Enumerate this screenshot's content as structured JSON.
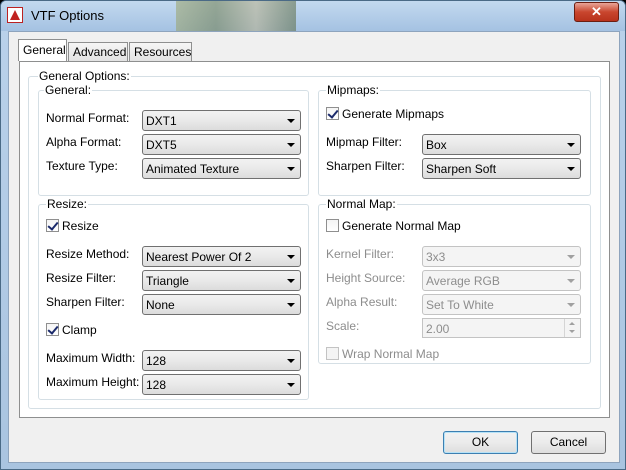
{
  "window": {
    "title": "VTF Options",
    "close_glyph": "✕"
  },
  "tabs": [
    {
      "label": "General",
      "active": true
    },
    {
      "label": "Advanced",
      "active": false
    },
    {
      "label": "Resources",
      "active": false
    }
  ],
  "general_options": {
    "legend": "General Options:",
    "general": {
      "legend": "General:",
      "normal_format": {
        "label": "Normal Format:",
        "value": "DXT1"
      },
      "alpha_format": {
        "label": "Alpha Format:",
        "value": "DXT5"
      },
      "texture_type": {
        "label": "Texture Type:",
        "value": "Animated Texture"
      }
    },
    "mipmaps": {
      "legend": "Mipmaps:",
      "generate_mipmaps": {
        "label": "Generate Mipmaps",
        "checked": true
      },
      "mipmap_filter": {
        "label": "Mipmap Filter:",
        "value": "Box"
      },
      "sharpen_filter": {
        "label": "Sharpen Filter:",
        "value": "Sharpen Soft"
      }
    },
    "resize": {
      "legend": "Resize:",
      "resize": {
        "label": "Resize",
        "checked": true
      },
      "resize_method": {
        "label": "Resize Method:",
        "value": "Nearest Power Of 2"
      },
      "resize_filter": {
        "label": "Resize Filter:",
        "value": "Triangle"
      },
      "sharpen_filter": {
        "label": "Sharpen Filter:",
        "value": "None"
      },
      "clamp": {
        "label": "Clamp",
        "checked": true
      },
      "maximum_width": {
        "label": "Maximum Width:",
        "value": "128"
      },
      "maximum_height": {
        "label": "Maximum Height:",
        "value": "128"
      }
    },
    "normal_map": {
      "legend": "Normal Map:",
      "generate_normal_map": {
        "label": "Generate Normal Map",
        "checked": false
      },
      "kernel_filter": {
        "label": "Kernel Filter:",
        "value": "3x3"
      },
      "height_source": {
        "label": "Height Source:",
        "value": "Average RGB"
      },
      "alpha_result": {
        "label": "Alpha Result:",
        "value": "Set To White"
      },
      "scale": {
        "label": "Scale:",
        "value": "2.00"
      },
      "wrap_normal_map": {
        "label": "Wrap Normal Map",
        "checked": false
      }
    }
  },
  "buttons": {
    "ok": "OK",
    "cancel": "Cancel"
  }
}
